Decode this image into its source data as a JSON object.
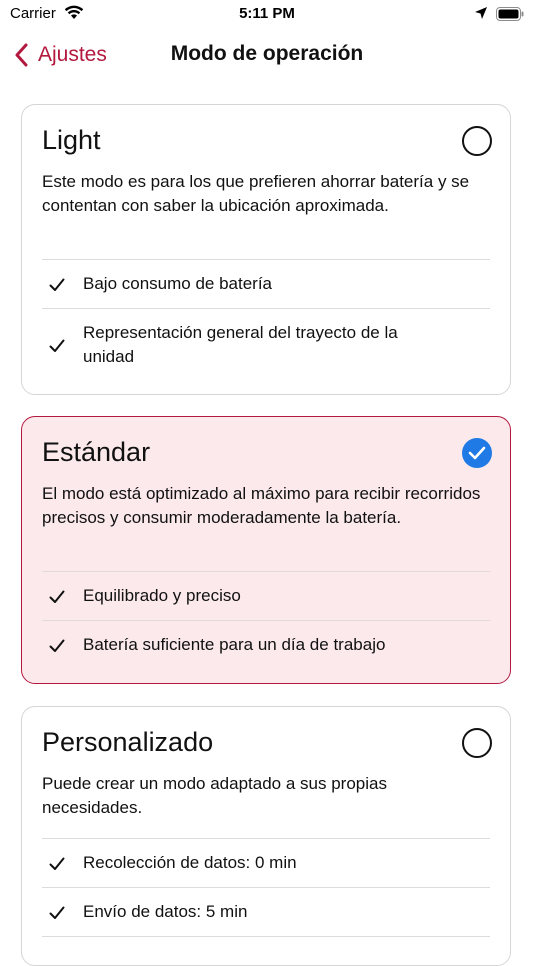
{
  "status_bar": {
    "carrier": "Carrier",
    "time": "5:11 PM"
  },
  "nav": {
    "back_label": "Ajustes",
    "title": "Modo de operación"
  },
  "accent_color": "#b3193f",
  "selected_color": "#1f7ae6",
  "modes": [
    {
      "title": "Light",
      "selected": false,
      "description": "Este modo es para los que prefieren ahorrar batería y se contentan con saber la ubicación aproximada.",
      "features": [
        "Bajo consumo de batería",
        "Representación general del trayecto de la unidad"
      ]
    },
    {
      "title": "Estándar",
      "selected": true,
      "description": "El modo está optimizado al máximo para recibir recorridos precisos y consumir moderadamente la batería.",
      "features": [
        "Equilibrado y preciso",
        "Batería suficiente para un día de trabajo"
      ]
    },
    {
      "title": "Personalizado",
      "selected": false,
      "description": "Puede crear un modo adaptado a sus propias necesidades.",
      "features": [
        "Recolección de datos: 0 min",
        "Envío de datos: 5 min"
      ]
    }
  ]
}
